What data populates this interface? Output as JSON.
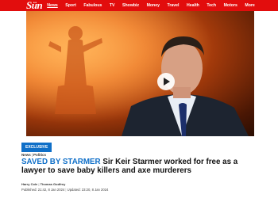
{
  "nav": {
    "logo": "Sün",
    "items": [
      "News",
      "Sport",
      "Fabulous",
      "TV",
      "Showbiz",
      "Money",
      "Travel",
      "Health",
      "Tech",
      "Motors",
      "More"
    ],
    "active": "News"
  },
  "video": {
    "play_icon": "play-icon"
  },
  "article": {
    "badge": "EXCLUSIVE",
    "breadcrumb": [
      "News",
      "Politics"
    ],
    "kicker": "SAVED BY STARMER",
    "headline": "Sir Keir Starmer worked for free as a lawyer to save baby killers and axe murderers",
    "authors": [
      "Harry Cole",
      "Thomas Godfrey"
    ],
    "published": "Published: 21:42, 8 Jan 2024",
    "updated": "Updated: 23:20, 8 Jan 2024"
  },
  "colors": {
    "brand_red": "#e20d0d",
    "accent_blue": "#0f6fc8"
  }
}
